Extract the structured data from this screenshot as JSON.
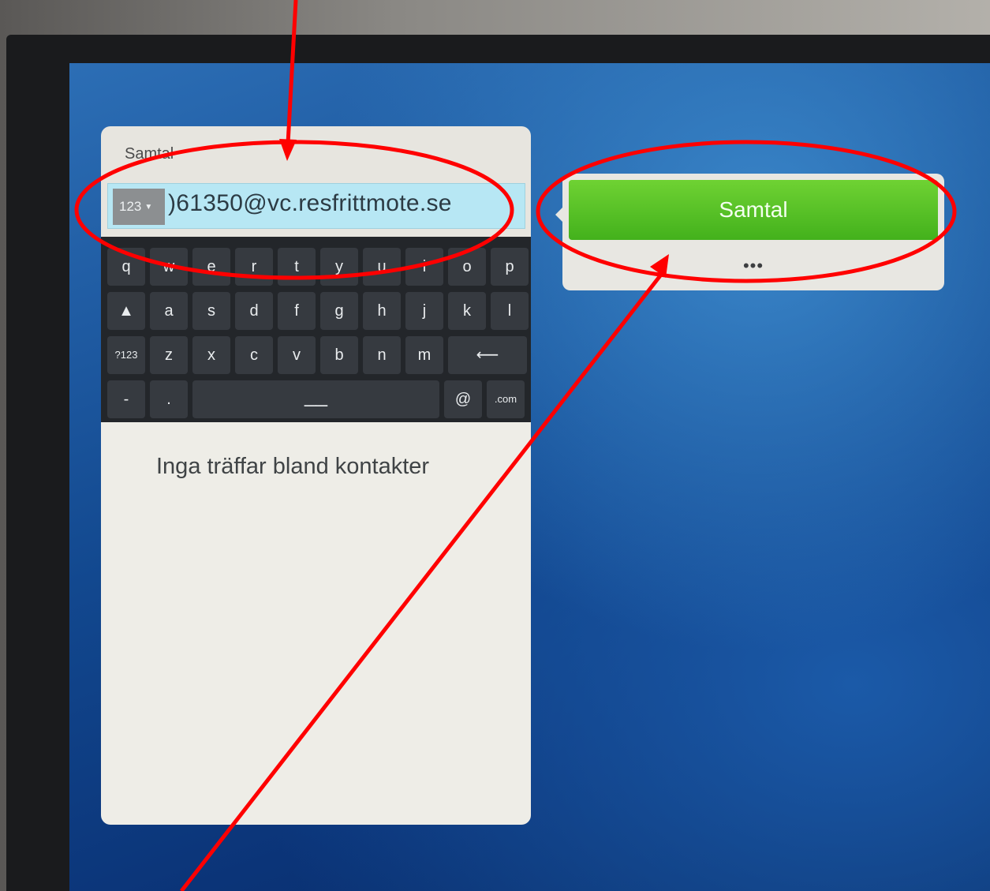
{
  "panel": {
    "title": "Samtal",
    "mode_button": "123",
    "dial_value": ")61350@vc.resfrittmote.se",
    "no_results": "Inga träffar bland kontakter"
  },
  "keyboard": {
    "row1": [
      "q",
      "w",
      "e",
      "r",
      "t",
      "y",
      "u",
      "i",
      "o",
      "p"
    ],
    "row2": [
      "a",
      "s",
      "d",
      "f",
      "g",
      "h",
      "j",
      "k",
      "l"
    ],
    "row3": [
      "z",
      "x",
      "c",
      "v",
      "b",
      "n",
      "m"
    ],
    "shift_icon": "shift-up-icon",
    "symbols_label": "?123",
    "backspace_icon": "backspace-arrow-icon",
    "dash_label": "-",
    "dot_label": ".",
    "space_label": "__",
    "at_label": "@",
    "dotcom_label": ".com"
  },
  "call": {
    "button_label": "Samtal",
    "more_label": "•••"
  },
  "annotations": {
    "color": "#ff0000"
  }
}
